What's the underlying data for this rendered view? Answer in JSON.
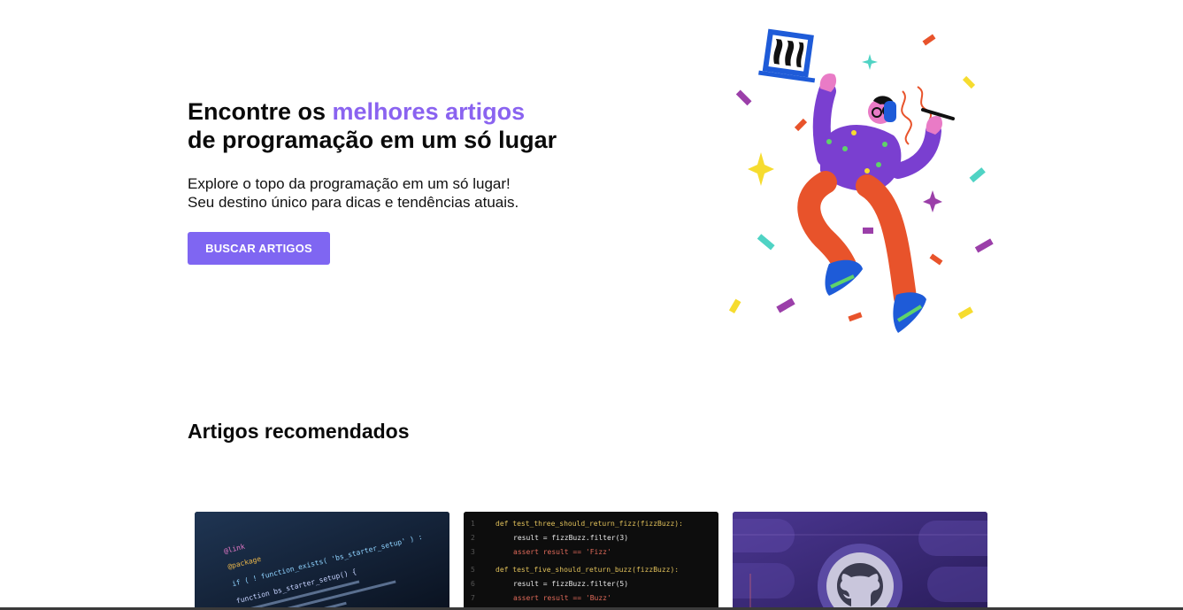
{
  "hero": {
    "title_prefix": "Encontre os ",
    "title_accent": "melhores artigos",
    "title_line2": "de programação em um só lugar",
    "subtitle_line1": "Explore o topo da programação em um só lugar!",
    "subtitle_line2": "Seu destino único para dicas e tendências atuais.",
    "cta_label": "BUSCAR ARTIGOS"
  },
  "colors": {
    "accent": "#8a63f0",
    "button": "#7f66f2"
  },
  "recommended": {
    "title": "Artigos recomendados",
    "cards": [
      {
        "icon": "code-screen-icon",
        "code_lines": [
          "@link",
          "@package",
          "if ( ! function_exists( 'bs_starter_setup' ) :",
          "function bs_starter_setup() {"
        ]
      },
      {
        "icon": "code-editor-icon",
        "code_lines": [
          "def test_three_should_return_fizz(fizzBuzz):",
          "result = fizzBuzz.filter(3)",
          "assert result == 'Fizz'",
          "def test_five_should_return_buzz(fizzBuzz):",
          "result = fizzBuzz.filter(5)",
          "assert result == 'Buzz'"
        ]
      },
      {
        "icon": "github-icon",
        "code_lines": []
      }
    ]
  }
}
